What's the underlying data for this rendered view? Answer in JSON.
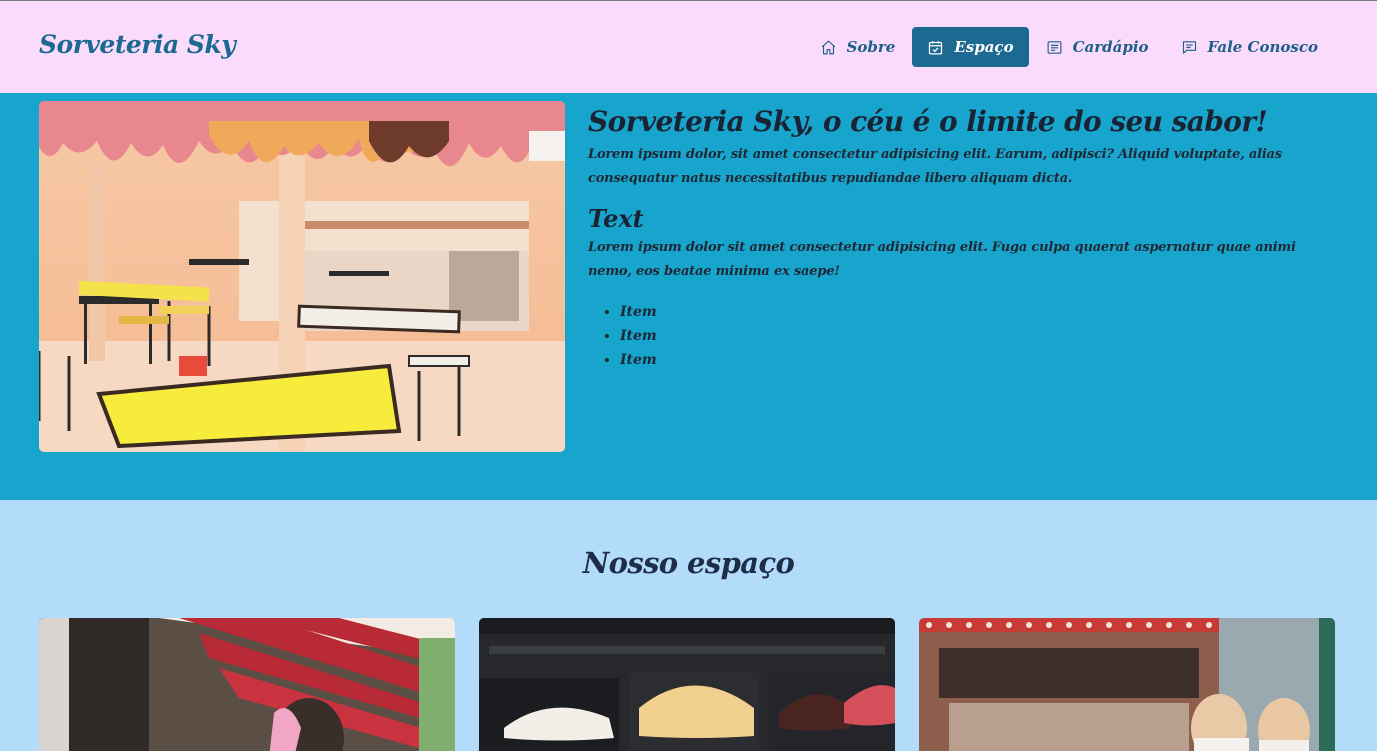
{
  "brand": "Sorveteria Sky",
  "nav": [
    {
      "label": "Sobre",
      "icon": "home-icon",
      "active": false
    },
    {
      "label": "Espaço",
      "icon": "calendar-check-icon",
      "active": true
    },
    {
      "label": "Cardápio",
      "icon": "list-icon",
      "active": false
    },
    {
      "label": "Fale Conosco",
      "icon": "chat-icon",
      "active": false
    }
  ],
  "hero": {
    "title": "Sorveteria Sky, o céu é o limite do seu sabor!",
    "paragraph1": "Lorem ipsum dolor, sit amet consectetur adipisicing elit. Earum, adipisci? Aliquid voluptate, alias consequatur natus necessitatibus repudiandae libero aliquam dicta.",
    "subtitle": "Text",
    "paragraph2": "Lorem ipsum dolor sit amet consectetur adipisicing elit. Fuga culpa quaerat aspernatur quae animi nemo, eos beatae minima ex saepe!",
    "items": [
      "Item",
      "Item",
      "Item"
    ]
  },
  "gallery": {
    "title": "Nosso espaço"
  },
  "colors": {
    "header_bg": "#fbdbfb",
    "accent": "#1c6a91",
    "hero_bg": "#18a5cd",
    "section_bg": "#b3dcfb"
  }
}
